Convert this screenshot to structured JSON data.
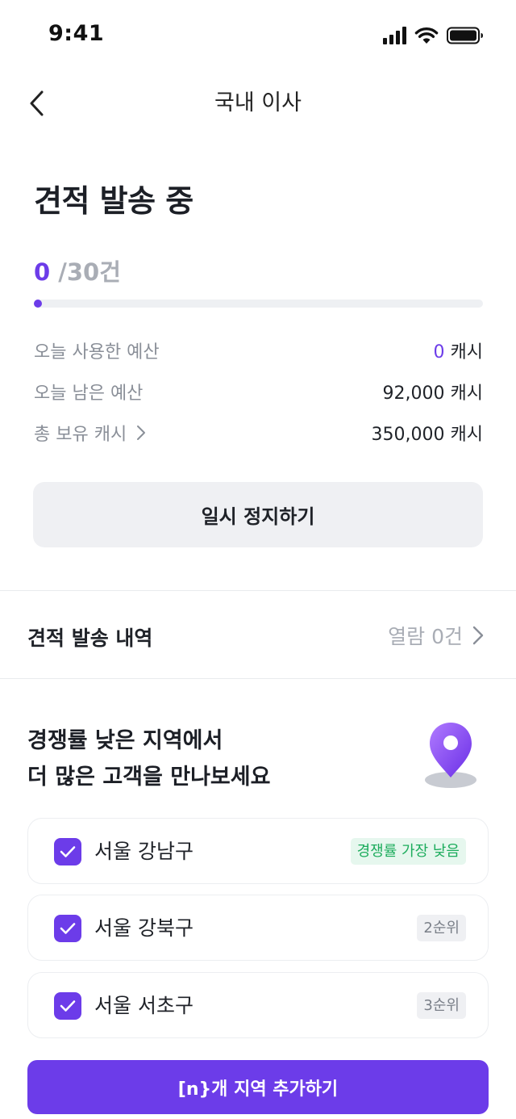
{
  "status_bar": {
    "time": "9:41"
  },
  "nav": {
    "title": "국내 이사"
  },
  "heading": "견적 발송 중",
  "progress": {
    "current": "0",
    "total": " /30건",
    "ratio": 0
  },
  "budget": {
    "used_label": "오늘 사용한 예산",
    "used_amount": "0",
    "used_unit": " 캐시",
    "remaining_label": "오늘 남은 예산",
    "remaining_value": "92,000 캐시",
    "total_label": "총 보유 캐시",
    "total_value": "350,000 캐시"
  },
  "pause_button": "일시 정지하기",
  "history": {
    "label": "견적 발송 내역",
    "status": "열람 0건"
  },
  "promo": {
    "line1": "경쟁률 낮은 지역에서",
    "line2": "더 많은 고객을 만나보세요"
  },
  "regions": [
    {
      "name": "서울 강남구",
      "badge": "경쟁률 가장 낮음",
      "checked": true
    },
    {
      "name": "서울 강북구",
      "badge": "2순위",
      "checked": true
    },
    {
      "name": "서울 서초구",
      "badge": "3순위",
      "checked": true
    }
  ],
  "add_button": "[n}개 지역 추가하기",
  "colors": {
    "accent": "#6c3ce9",
    "badge_green_bg": "#e6f7ee",
    "badge_green_text": "#1cac5c",
    "badge_gray_bg": "#eff0f3"
  },
  "icons": {
    "back": "chevron-left-icon",
    "history_chevron": "chevron-right-icon",
    "total_chevron": "chevron-right-icon",
    "pin": "location-pin-icon",
    "check": "checkmark-icon"
  }
}
